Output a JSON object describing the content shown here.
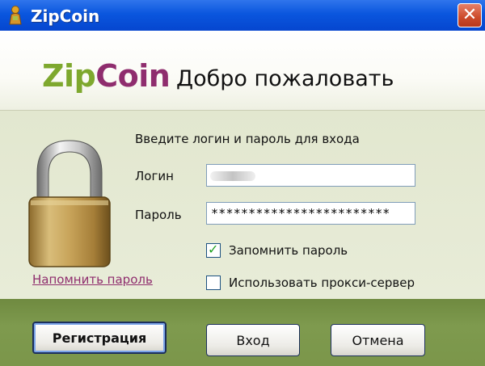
{
  "window": {
    "title": "ZipCoin"
  },
  "banner": {
    "logo_part1": "Zip",
    "logo_part2": "Coin",
    "welcome": "Добро пожаловать"
  },
  "form": {
    "prompt": "Введите логин и пароль для входа",
    "login_label": "Логин",
    "login_value": "",
    "password_label": "Пароль",
    "password_value": "************************",
    "remember_label": "Запомнить пароль",
    "remember_checked": true,
    "proxy_label": "Использовать прокси-сервер",
    "proxy_checked": false,
    "remind_link": "Напомнить пароль"
  },
  "buttons": {
    "register": "Регистрация",
    "login": "Вход",
    "cancel": "Отмена"
  },
  "icons": {
    "title": "zipcoin-app-icon",
    "close": "close-icon",
    "lock": "padlock-icon",
    "check": "checkmark-icon"
  },
  "colors": {
    "titlebar": "#0a56de",
    "logo_green": "#7ea82e",
    "logo_purple": "#8f2d6e",
    "footer": "#7b964a"
  }
}
